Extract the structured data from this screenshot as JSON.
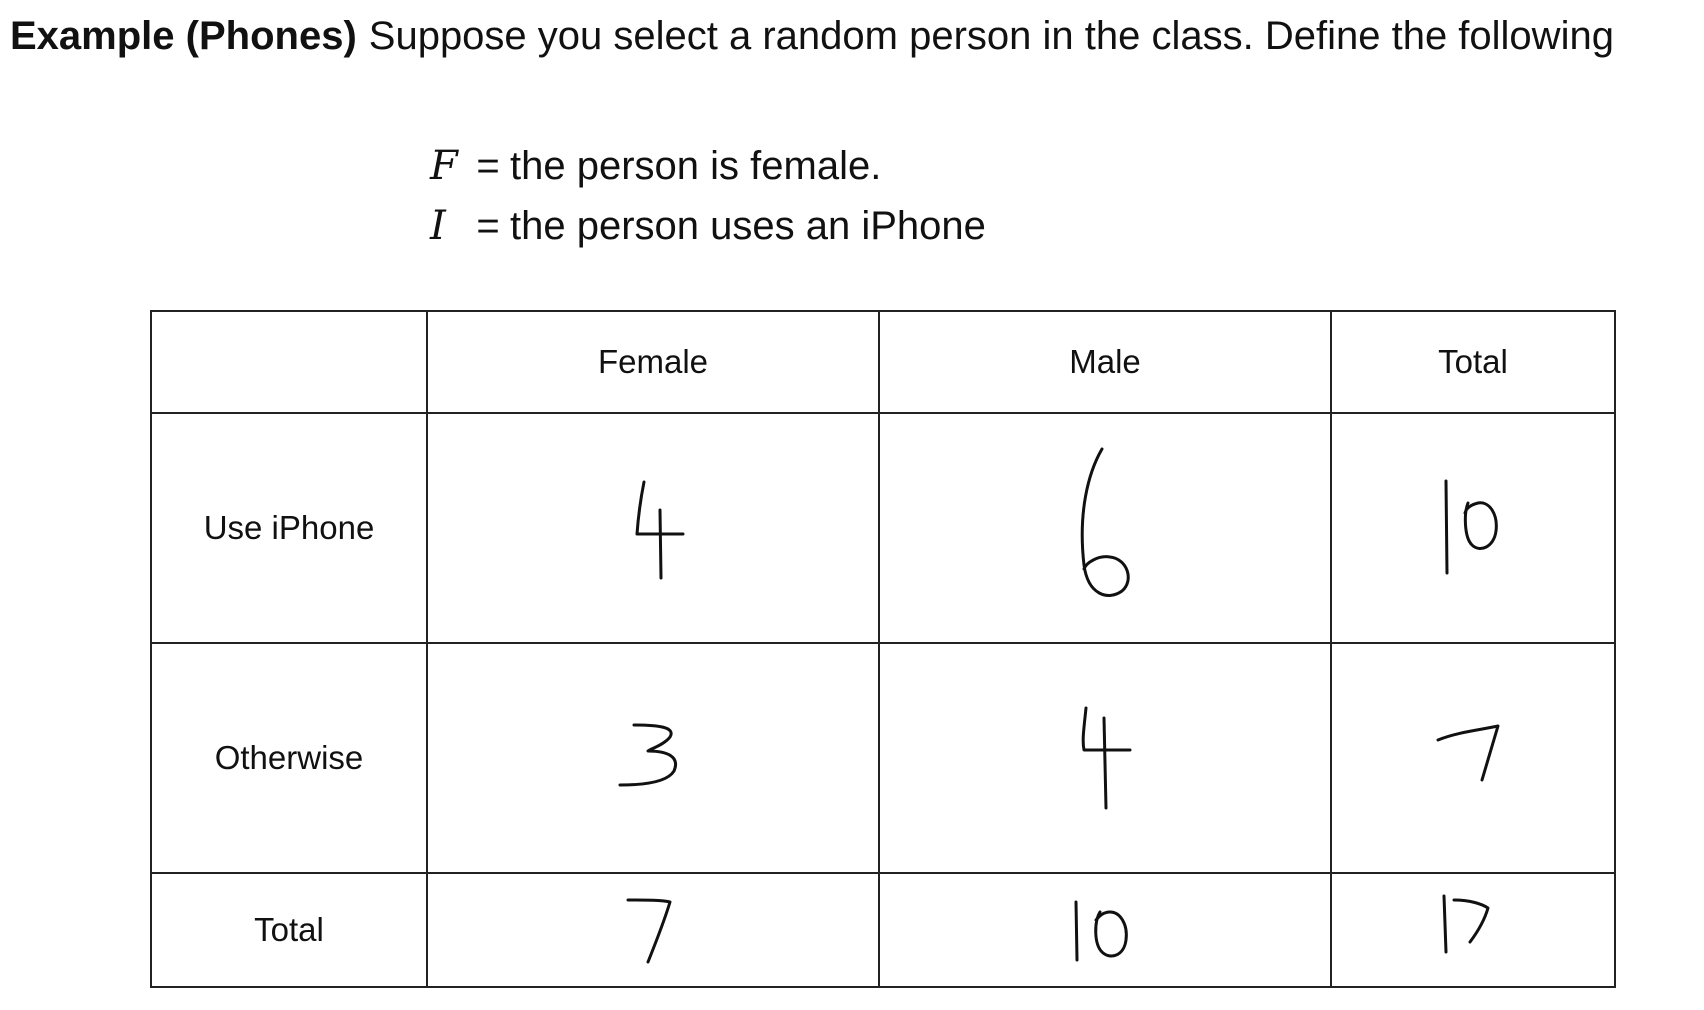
{
  "heading": {
    "bold": "Example (Phones)",
    "text": "Suppose you select a random person in the class. Define the following"
  },
  "definitions": [
    {
      "var": "F",
      "eq": "=",
      "text": "the person is female."
    },
    {
      "var": "I",
      "eq": "=",
      "text": "the person uses an iPhone"
    }
  ],
  "table": {
    "columns": [
      "",
      "Female",
      "Male",
      "Total"
    ],
    "rows": [
      {
        "label": "Use iPhone",
        "values": [
          "4",
          "6",
          "10"
        ]
      },
      {
        "label": "Otherwise",
        "values": [
          "3",
          "4",
          "7"
        ]
      },
      {
        "label": "Total",
        "values": [
          "7",
          "10",
          "17"
        ]
      }
    ]
  }
}
